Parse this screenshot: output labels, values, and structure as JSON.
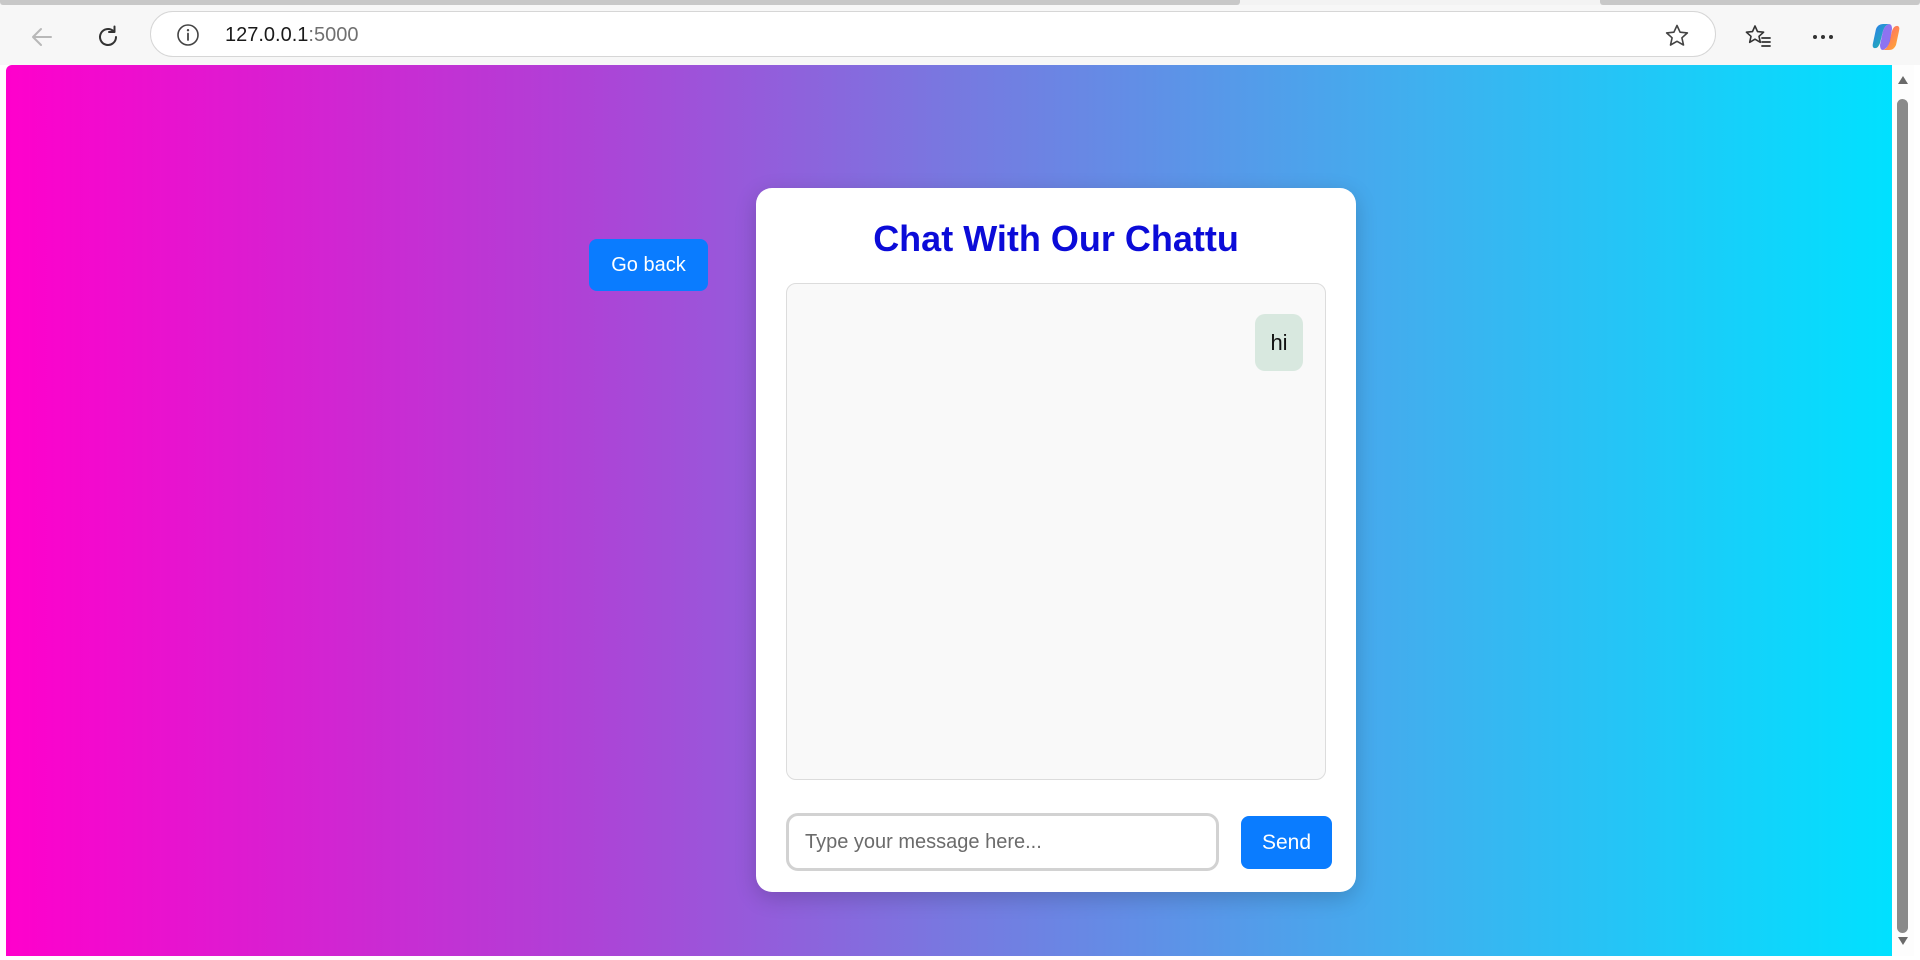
{
  "browser": {
    "url_host": "127.0.0.1",
    "url_port": ":5000",
    "icons": [
      "back-icon",
      "reload-icon",
      "info-icon",
      "star-icon",
      "favorites-icon",
      "more-icon",
      "copilot-icon"
    ]
  },
  "page": {
    "go_back_label": "Go back",
    "chat": {
      "title": "Chat With Our Chattu",
      "messages": [
        {
          "sender": "user",
          "text": "hi"
        }
      ],
      "input_placeholder": "Type your message here...",
      "input_value": "",
      "send_label": "Send"
    },
    "colors": {
      "gradient_start": "#ff00cc",
      "gradient_end": "#00e1ff",
      "accent_button": "#0a7cff",
      "title_color": "#0b0bd8",
      "user_bubble": "#d8e8df"
    }
  }
}
